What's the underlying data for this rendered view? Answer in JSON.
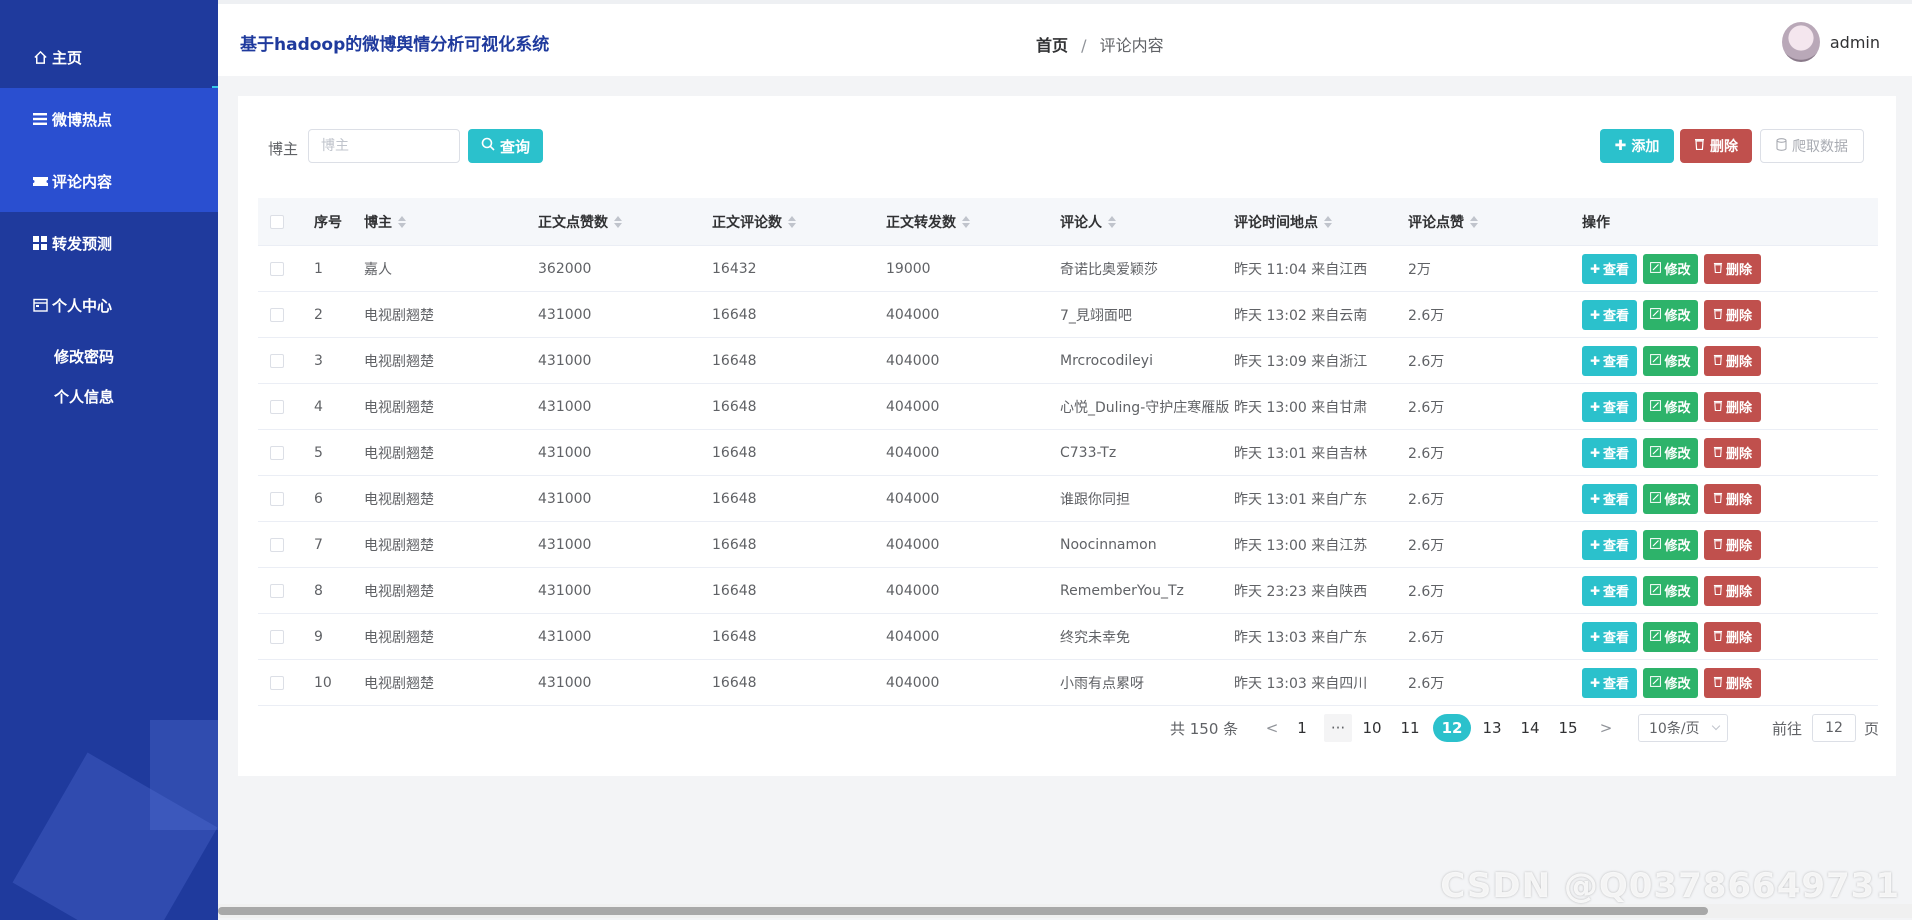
{
  "sidebar": {
    "items": [
      {
        "label": "主页",
        "icon": "home-icon"
      },
      {
        "label": "微博热点",
        "icon": "list-icon"
      },
      {
        "label": "评论内容",
        "icon": "ticket-icon"
      },
      {
        "label": "转发预测",
        "icon": "grid-icon"
      },
      {
        "label": "个人中心",
        "icon": "calendar-icon"
      }
    ],
    "subitems": [
      {
        "label": "修改密码"
      },
      {
        "label": "个人信息"
      }
    ]
  },
  "header": {
    "title": "基于hadoop的微博舆情分析可视化系统",
    "breadcrumb_home": "首页",
    "breadcrumb_sep": "/",
    "breadcrumb_current": "评论内容",
    "username": "admin"
  },
  "toolbar": {
    "search_label": "博主",
    "search_placeholder": "博主",
    "query_label": "查询",
    "add_label": "添加",
    "delete_label": "删除",
    "crawl_label": "爬取数据"
  },
  "table": {
    "columns": [
      "序号",
      "博主",
      "正文点赞数",
      "正文评论数",
      "正文转发数",
      "评论人",
      "评论时间地点",
      "评论点赞",
      "操作"
    ],
    "rows": [
      [
        "1",
        "嘉人",
        "362000",
        "16432",
        "19000",
        "奇诺比奥爱颖莎",
        "昨天 11:04 来自江西",
        "2万"
      ],
      [
        "2",
        "电视剧翘楚",
        "431000",
        "16648",
        "404000",
        "7_見翊面吧",
        "昨天 13:02 来自云南",
        "2.6万"
      ],
      [
        "3",
        "电视剧翘楚",
        "431000",
        "16648",
        "404000",
        "Mrcrocodileyi",
        "昨天 13:09 来自浙江",
        "2.6万"
      ],
      [
        "4",
        "电视剧翘楚",
        "431000",
        "16648",
        "404000",
        "心悦_Duling-守护庄寒雁版",
        "昨天 13:00 来自甘肃",
        "2.6万"
      ],
      [
        "5",
        "电视剧翘楚",
        "431000",
        "16648",
        "404000",
        "C733-Tz",
        "昨天 13:01 来自吉林",
        "2.6万"
      ],
      [
        "6",
        "电视剧翘楚",
        "431000",
        "16648",
        "404000",
        "谁跟你同担",
        "昨天 13:01 来自广东",
        "2.6万"
      ],
      [
        "7",
        "电视剧翘楚",
        "431000",
        "16648",
        "404000",
        "Noocinnamon",
        "昨天 13:00 来自江苏",
        "2.6万"
      ],
      [
        "8",
        "电视剧翘楚",
        "431000",
        "16648",
        "404000",
        "RememberYou_Tz",
        "昨天 23:23 来自陕西",
        "2.6万"
      ],
      [
        "9",
        "电视剧翘楚",
        "431000",
        "16648",
        "404000",
        "终究未幸免",
        "昨天 13:03 来自广东",
        "2.6万"
      ],
      [
        "10",
        "电视剧翘楚",
        "431000",
        "16648",
        "404000",
        "小雨有点累呀",
        "昨天 13:03 来自四川",
        "2.6万"
      ]
    ],
    "actions": {
      "view": "查看",
      "edit": "修改",
      "delete": "删除"
    }
  },
  "pagination": {
    "total_text": "共 150 条",
    "prev": "<",
    "next": ">",
    "more": "···",
    "pages": [
      "1",
      "10",
      "11",
      "12",
      "13",
      "14",
      "15"
    ],
    "current": "12",
    "page_size": "10条/页",
    "goto_label": "前往",
    "goto_value": "12",
    "page_suffix": "页"
  },
  "watermark": "CSDN @Q0378664973​1",
  "colors": {
    "sidebar": "#1f3a9d",
    "sidebar_active": "#2a4fd0",
    "accent": "#2bc1cc",
    "edit": "#2db36a",
    "danger": "#c0504d"
  }
}
